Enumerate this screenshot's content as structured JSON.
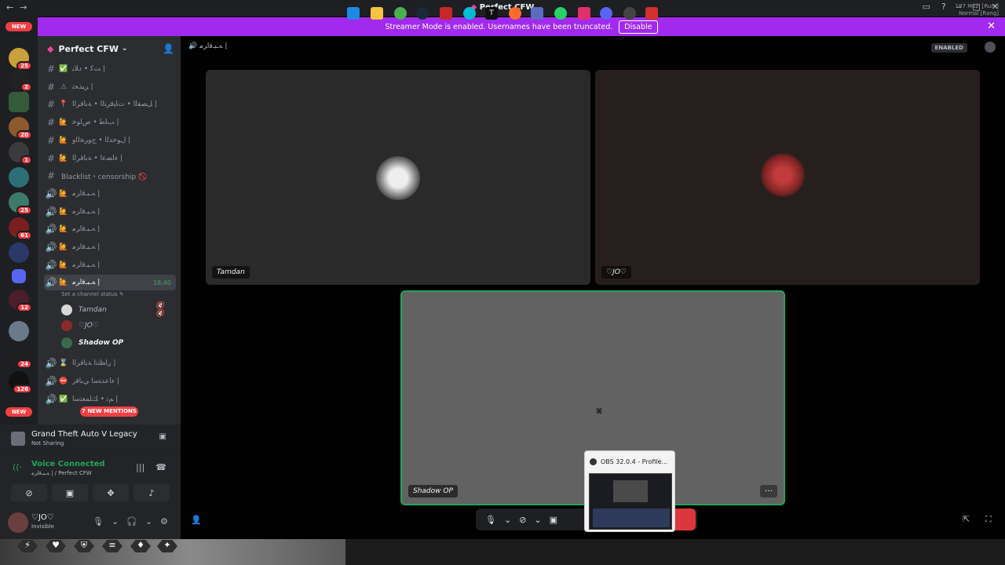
{
  "titlebar": {
    "title": "Perfect CFW",
    "back": "←",
    "forward": "→"
  },
  "banner": {
    "text": "Streamer Mode is enabled. Usernames have been truncated.",
    "disable_label": "Disable",
    "close": "✕"
  },
  "guilds": {
    "new_top": "NEW",
    "new_bottom": "NEW",
    "badges": [
      "25",
      "2",
      "20",
      "1",
      "25",
      "61",
      "12",
      "24",
      "126"
    ]
  },
  "server": {
    "name": "Perfect CFW"
  },
  "channels": [
    {
      "emoji": "✅",
      "name": "ﺖﻛ • ﺩﻼﺑ |",
      "type": "text"
    },
    {
      "emoji": "⚠",
      "name": "ﺮﻴﺬﺤﺗ |",
      "type": "text"
    },
    {
      "emoji": "📍",
      "name": "ﻞﺼﻔﻟﺍ • ﺕﺎﻴﻗﺮﺘﻟﺍ • ﺔﺑﺎﻗﺮﻟﺍ |",
      "type": "text"
    },
    {
      "emoji": "🙋",
      "name": "ﺐﻠﻃ • ﺹﺍﻮﺧ |",
      "type": "text"
    },
    {
      "emoji": "🙋",
      "name": "ﻝﻮﺧﺪﻟﺍ • ﺝﻭﺮﺨﻟﺍﻭ |",
      "type": "text"
    },
    {
      "emoji": "🙋",
      "name": "ﺀﺎﻀﻋﺍ • ﺔﺑﺎﻗﺮﻟﺍ |",
      "type": "text"
    },
    {
      "emoji": "",
      "name": "Blacklist・censorship 🚫",
      "type": "text"
    },
    {
      "emoji": "🙋",
      "name": "ﻪـﺒـﻗﺍﺮﻣ |",
      "type": "voice"
    },
    {
      "emoji": "🙋",
      "name": "ﻪـﺒـﻗﺍﺮﻣ |",
      "type": "voice"
    },
    {
      "emoji": "🙋",
      "name": "ﻪـﺒـﻗﺍﺮﻣ |",
      "type": "voice"
    },
    {
      "emoji": "🙋",
      "name": "ﻪـﺒـﻗﺍﺮﻣ |",
      "type": "voice"
    },
    {
      "emoji": "🙋",
      "name": "ﻪـﺒـﻗﺍﺮﻣ |",
      "type": "voice"
    },
    {
      "emoji": "🙋",
      "name": "ﻪـﺒـﻗﺍﺮﻣ |",
      "type": "voice",
      "active": true,
      "time": "18:40"
    }
  ],
  "channel_status": "Set a channel status ✎",
  "members": [
    {
      "name": "Tamdan",
      "mute": "🔇 🔇"
    },
    {
      "name": "♡JO♡",
      "mute": ""
    },
    {
      "name": "Shadow OP",
      "mute": ""
    }
  ],
  "channels_below": [
    {
      "emoji": "⌛",
      "name": "ﺭﺎﻈﺘﻧﺍ ﺔﺑﺎﻗﺮﻟﺍ |"
    },
    {
      "emoji": "⛔",
      "name": "ﺀﺎﻋﺪﺘﺳﺍ ﻲﺑﺎﻗﺭ |"
    },
    {
      "emoji": "✅",
      "name": "ﻢﺗ • ﻚﻠﻤﻌﺘﺳﺍ |"
    }
  ],
  "mentions_pill": "7 NEW MENTIONS",
  "activity": {
    "game": "Grand Theft Auto V Legacy",
    "status": "Not Sharing"
  },
  "voice": {
    "title": "Voice Connected",
    "sub": "ﻪـﺒـﻗﺍﺮﻣ | / Perfect CFW"
  },
  "user": {
    "name": "♡JO♡",
    "status": "Invisible"
  },
  "stage": {
    "channel_label": "ﻪـﺒـﻗﺍﺮﻣ |",
    "enabled_label": "ENABLED"
  },
  "tiles": [
    {
      "name": "Tamdan"
    },
    {
      "name": "♡JO♡"
    },
    {
      "name": "Shadow OP"
    }
  ],
  "obs": {
    "title": "OBS 32.0.4 - Profile..."
  },
  "tray": {
    "line1": "187 Muz, [Rum]",
    "line2": "Normal [Rang]"
  }
}
